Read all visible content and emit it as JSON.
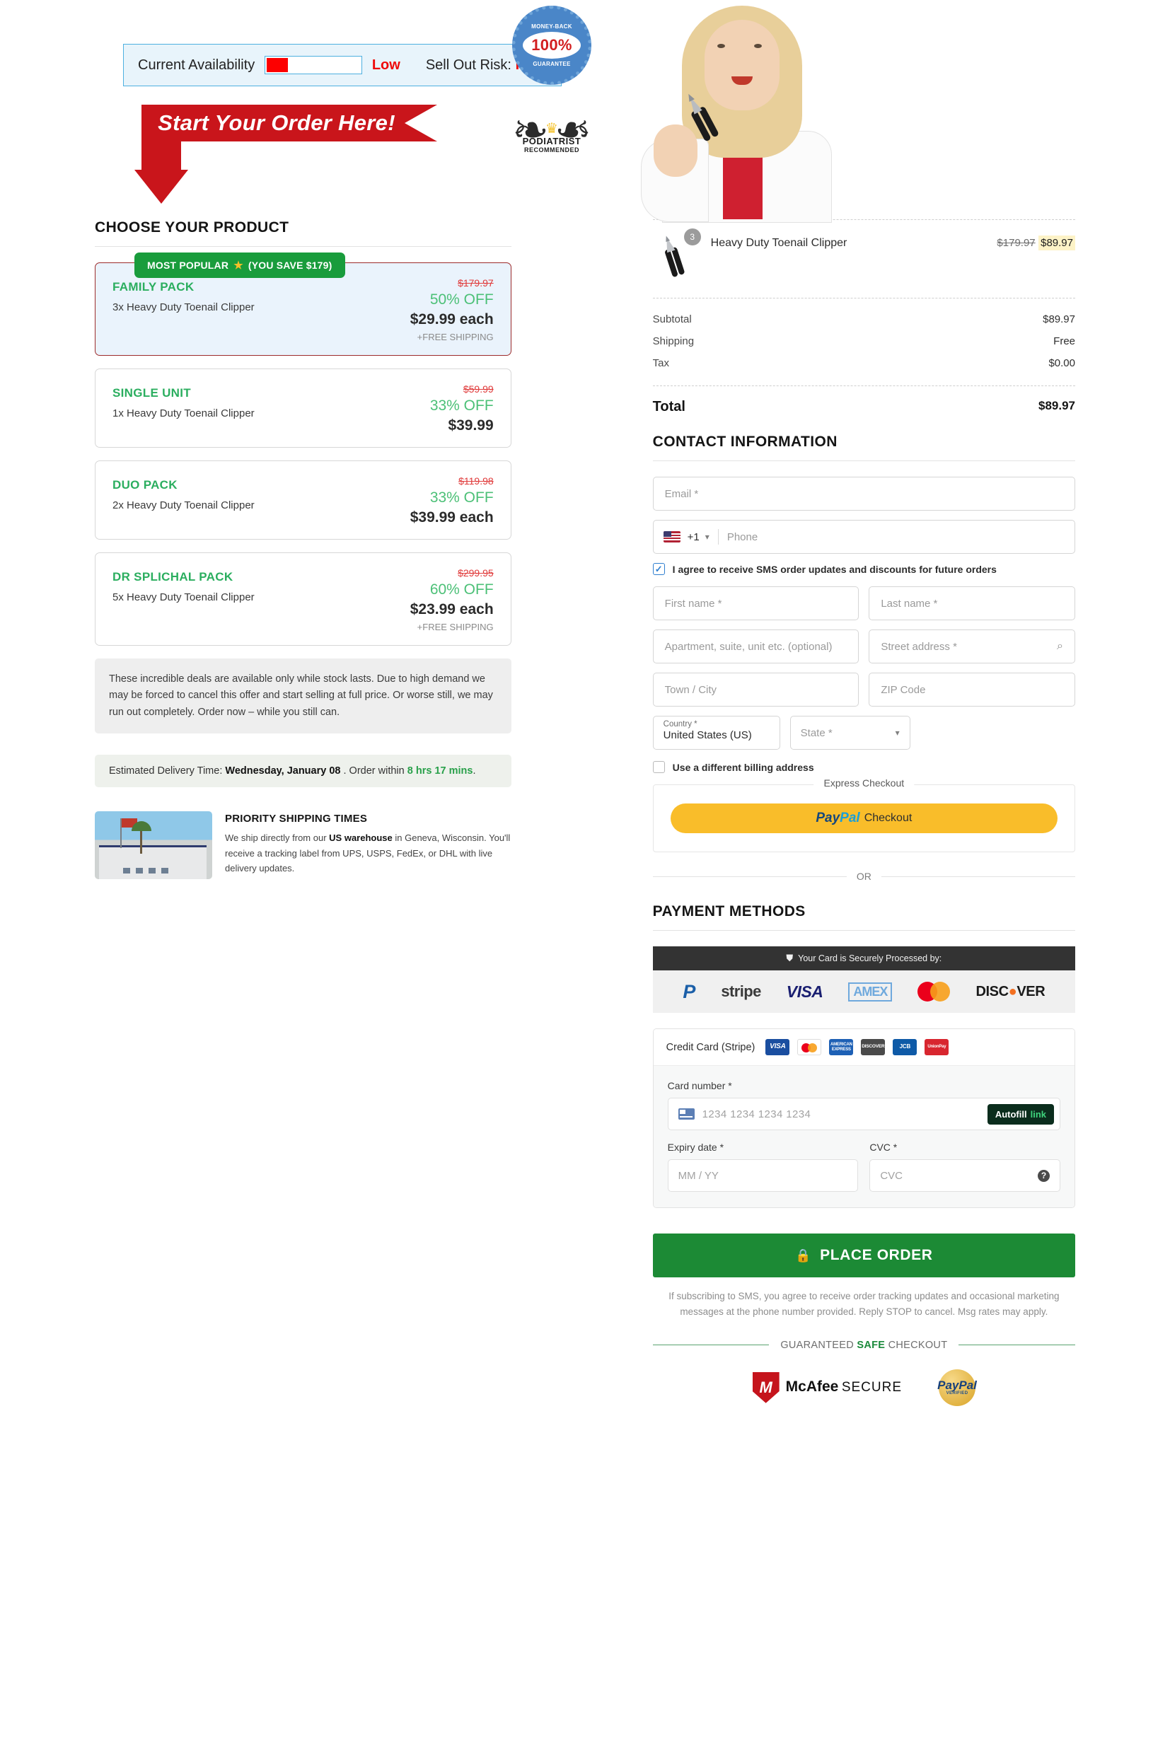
{
  "hero": {
    "availability_label": "Current Availability",
    "availability_status": "Low",
    "sellout_prefix": "Sell Out Risk:",
    "sellout_value": "High",
    "start_banner": "Start Your Order Here!",
    "badge_money_back_top": "MONEY-BACK",
    "badge_money_back_pct": "100%",
    "badge_money_back_bottom": "GUARANTEE",
    "badge_podiatrist_l1": "PODIATRIST",
    "badge_podiatrist_l2": "RECOMMENDED"
  },
  "products": {
    "heading": "CHOOSE YOUR PRODUCT",
    "popular_badge": "MOST POPULAR",
    "popular_save": "(YOU SAVE $179)",
    "items": [
      {
        "title": "FAMILY PACK",
        "desc": "3x Heavy Duty Toenail Clipper",
        "old_price": "$179.97",
        "discount": "50% OFF",
        "price": "$29.99 each",
        "shipping": "+FREE SHIPPING"
      },
      {
        "title": "SINGLE UNIT",
        "desc": "1x Heavy Duty Toenail Clipper",
        "old_price": "$59.99",
        "discount": "33% OFF",
        "price": "$39.99",
        "shipping": ""
      },
      {
        "title": "DUO PACK",
        "desc": "2x Heavy Duty Toenail Clipper",
        "old_price": "$119.98",
        "discount": "33% OFF",
        "price": "$39.99 each",
        "shipping": ""
      },
      {
        "title": "DR SPLICHAL PACK",
        "desc": "5x Heavy Duty Toenail Clipper",
        "old_price": "$299.95",
        "discount": "60% OFF",
        "price": "$23.99 each",
        "shipping": "+FREE SHIPPING"
      }
    ],
    "scarcity": "These incredible deals are available only while stock lasts. Due to high demand we may be forced to cancel this offer and start selling at full price. Or worse still, we may run out completely. Order now – while you still can.",
    "eta_prefix": "Estimated Delivery Time:",
    "eta_date": "Wednesday, January 08",
    "eta_mid": ". Order within",
    "eta_countdown": "8 hrs 17 mins",
    "eta_suffix": "."
  },
  "shipping": {
    "title": "PRIORITY SHIPPING TIMES",
    "line1_a": "We ship directly from our",
    "line1_b": "US warehouse",
    "line1_c": "in Geneva, Wisconsin.",
    "line2": "You'll receive a tracking label from UPS, USPS, FedEx, or DHL with live delivery updates."
  },
  "order": {
    "item_name": "Heavy Duty Toenail Clipper",
    "item_qty": "3",
    "item_old_price": "$179.97",
    "item_price": "$89.97",
    "rows": [
      {
        "label": "Subtotal",
        "value": "$89.97"
      },
      {
        "label": "Shipping",
        "value": "Free"
      },
      {
        "label": "Tax",
        "value": "$0.00"
      }
    ],
    "total_label": "Total",
    "total_value": "$89.97"
  },
  "contact": {
    "heading": "CONTACT INFORMATION",
    "email_placeholder": "Email *",
    "country_code": "+1",
    "phone_placeholder": "Phone",
    "sms_consent": "I agree to receive SMS order updates and discounts for future orders",
    "first_name_placeholder": "First name *",
    "last_name_placeholder": "Last name *",
    "apartment_placeholder": "Apartment, suite, unit etc. (optional)",
    "street_placeholder": "Street address *",
    "city_placeholder": "Town / City",
    "zip_placeholder": "ZIP Code",
    "country_label": "Country *",
    "country_value": "United States (US)",
    "state_placeholder": "State *",
    "billing_checkbox": "Use a different billing address"
  },
  "express": {
    "legend": "Express Checkout",
    "paypal_pay": "Pay",
    "paypal_pal": "Pal",
    "paypal_checkout": "Checkout",
    "or": "OR"
  },
  "payment": {
    "heading": "PAYMENT METHODS",
    "secure_text": "Your Card is Securely Processed by:",
    "logos": [
      "PayPal",
      "stripe",
      "VISA",
      "AMEX",
      "Mastercard",
      "DISCOVER"
    ],
    "cc_label": "Credit Card (Stripe)",
    "cc_brands": [
      "VISA",
      "Mastercard",
      "AMERICAN EXPRESS",
      "DISCOVER",
      "JCB",
      "UnionPay"
    ],
    "card_number_label": "Card number *",
    "card_number_placeholder": "1234 1234 1234 1234",
    "autofill_label": "Autofill",
    "autofill_link": "link",
    "expiry_label": "Expiry date *",
    "expiry_placeholder": "MM / YY",
    "cvc_label": "CVC *",
    "cvc_placeholder": "CVC"
  },
  "footer": {
    "place_order": "PLACE ORDER",
    "sms_note": "If subscribing to SMS, you agree to receive order tracking updates and occasional marketing messages at the phone number provided. Reply STOP to cancel. Msg rates may apply.",
    "safe_pre": "GUARANTEED",
    "safe_bold": "SAFE",
    "safe_post": "CHECKOUT",
    "mcafee_1": "McAfee",
    "mcafee_2": "SECURE",
    "paypal_verified_1": "PayPal",
    "paypal_verified_2": "VERIFIED"
  },
  "colors": {
    "green": "#199c3c",
    "red": "#c9151b",
    "accent_blue": "#4db0e0",
    "paypal_yellow": "#f9bd2a"
  }
}
